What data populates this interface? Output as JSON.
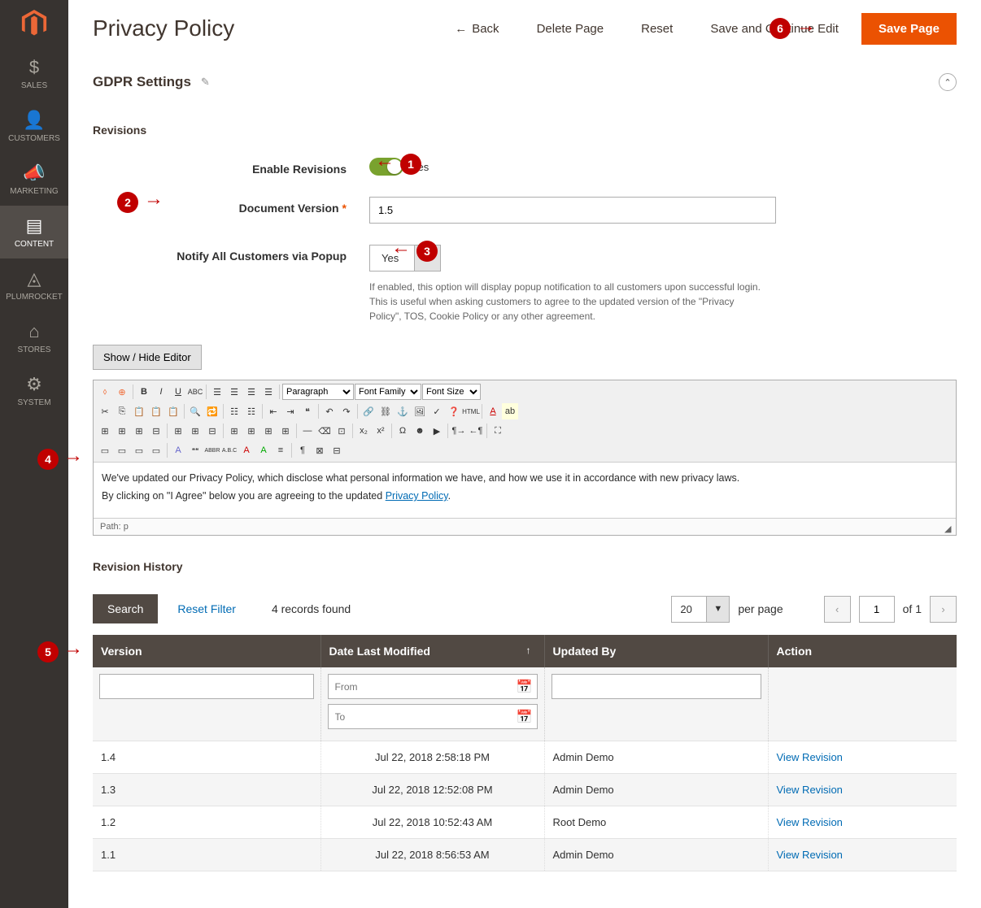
{
  "sidebar": {
    "items": [
      {
        "label": "SALES",
        "icon": "$"
      },
      {
        "label": "CUSTOMERS",
        "icon": "👤"
      },
      {
        "label": "MARKETING",
        "icon": "📢"
      },
      {
        "label": "CONTENT",
        "icon": "▣",
        "active": true
      },
      {
        "label": "PLUMROCKET",
        "icon": "▲"
      },
      {
        "label": "STORES",
        "icon": "🏪"
      },
      {
        "label": "SYSTEM",
        "icon": "⚙"
      }
    ]
  },
  "header": {
    "title": "Privacy Policy",
    "back": "Back",
    "delete": "Delete Page",
    "reset": "Reset",
    "save_continue": "Save and Continue Edit",
    "save": "Save Page"
  },
  "annotations": {
    "b1": "1",
    "b2": "2",
    "b3": "3",
    "b4": "4",
    "b5": "5",
    "b6": "6"
  },
  "gdpr": {
    "title": "GDPR Settings",
    "revisions_title": "Revisions",
    "enable_revisions_label": "Enable Revisions",
    "enable_revisions_value": "Yes",
    "doc_version_label": "Document Version",
    "doc_version_value": "1.5",
    "notify_label": "Notify All Customers via Popup",
    "notify_value": "Yes",
    "notify_help": "If enabled, this option will display popup notification to all customers upon successful login. This is useful when asking customers to agree to the updated version of the \"Privacy Policy\", TOS, Cookie Policy or any other agreement.",
    "show_hide": "Show / Hide Editor"
  },
  "editor": {
    "format_options": "Paragraph",
    "font_family": "Font Family",
    "font_size": "Font Size",
    "content_line1": "We've updated our Privacy Policy, which disclose what personal information we have, and how we use it in accordance with new privacy laws.",
    "content_line2_pre": "By clicking on \"I Agree\" below you are agreeing to the updated ",
    "content_line2_link": "Privacy Policy",
    "path": "Path: p"
  },
  "history": {
    "title": "Revision History",
    "search": "Search",
    "reset_filter": "Reset Filter",
    "records_found": "4 records found",
    "per_page_value": "20",
    "per_page_label": "per page",
    "page_value": "1",
    "page_of": "of 1",
    "columns": {
      "version": "Version",
      "date": "Date Last Modified",
      "updated_by": "Updated By",
      "action": "Action"
    },
    "filter_from": "From",
    "filter_to": "To",
    "rows": [
      {
        "version": "1.4",
        "date": "Jul 22, 2018 2:58:18 PM",
        "by": "Admin Demo",
        "action": "View Revision"
      },
      {
        "version": "1.3",
        "date": "Jul 22, 2018 12:52:08 PM",
        "by": "Admin Demo",
        "action": "View Revision"
      },
      {
        "version": "1.2",
        "date": "Jul 22, 2018 10:52:43 AM",
        "by": "Root Demo",
        "action": "View Revision"
      },
      {
        "version": "1.1",
        "date": "Jul 22, 2018 8:56:53 AM",
        "by": "Admin Demo",
        "action": "View Revision"
      }
    ]
  }
}
